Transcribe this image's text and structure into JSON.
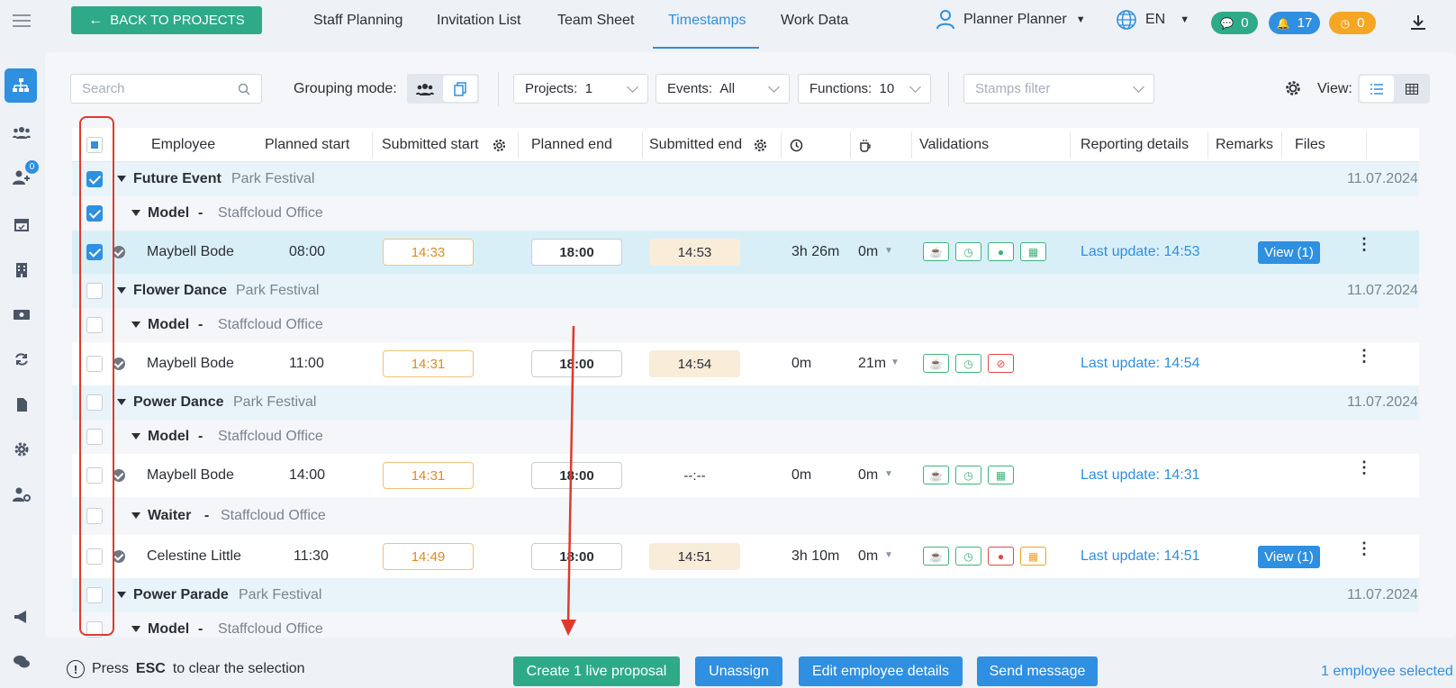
{
  "topbar": {
    "back_label": "BACK TO PROJECTS",
    "tabs": [
      "Staff Planning",
      "Invitation List",
      "Team Sheet",
      "Timestamps",
      "Work Data"
    ],
    "user_name": "Planner Planner",
    "language": "EN",
    "messages_count": "0",
    "notifications_count": "17",
    "alerts_count": "0"
  },
  "sidebar": {
    "badge": "0"
  },
  "filters": {
    "search_placeholder": "Search",
    "grouping_label": "Grouping mode:",
    "projects_label": "Projects:",
    "projects_value": "1",
    "events_label": "Events:",
    "events_value": "All",
    "functions_label": "Functions:",
    "functions_value": "10",
    "stamps_placeholder": "Stamps filter",
    "view_label": "View:"
  },
  "table": {
    "headers": {
      "employee": "Employee",
      "planned_start": "Planned start",
      "submitted_start": "Submitted start",
      "planned_end": "Planned end",
      "submitted_end": "Submitted end",
      "validations": "Validations",
      "reporting": "Reporting details",
      "remarks": "Remarks",
      "files": "Files"
    },
    "events": [
      {
        "name": "Future Event",
        "place": "Park Festival",
        "date": "11.07.2024"
      },
      {
        "name": "Flower Dance",
        "place": "Park Festival",
        "date": "11.07.2024"
      },
      {
        "name": "Power Dance",
        "place": "Park Festival",
        "date": "11.07.2024"
      },
      {
        "name": "Power Parade",
        "place": "Park Festival",
        "date": "11.07.2024"
      }
    ],
    "functions": [
      {
        "name": "Model",
        "sep": "-",
        "office": "Staffcloud Office"
      },
      {
        "name": "Model",
        "sep": "-",
        "office": "Staffcloud Office"
      },
      {
        "name": "Model",
        "sep": "-",
        "office": "Staffcloud Office"
      },
      {
        "name": "Waiter",
        "sep": "-",
        "office": "Staffcloud Office"
      },
      {
        "name": "Model",
        "sep": "-",
        "office": "Staffcloud Office"
      }
    ],
    "employees": [
      {
        "name": "Maybell Bode",
        "planned_start": "08:00",
        "submitted_start": "14:33",
        "planned_end": "18:00",
        "submitted_end": "14:53",
        "duration": "3h 26m",
        "break": "0m",
        "reporting": "Last update: 14:53",
        "files": "View (1)"
      },
      {
        "name": "Maybell Bode",
        "planned_start": "11:00",
        "submitted_start": "14:31",
        "planned_end": "18:00",
        "submitted_end": "14:54",
        "duration": "0m",
        "break": "21m",
        "reporting": "Last update: 14:54",
        "files": ""
      },
      {
        "name": "Maybell Bode",
        "planned_start": "14:00",
        "submitted_start": "14:31",
        "planned_end": "18:00",
        "submitted_end": "--:--",
        "duration": "0m",
        "break": "0m",
        "reporting": "Last update: 14:31",
        "files": ""
      },
      {
        "name": "Celestine Little",
        "planned_start": "11:30",
        "submitted_start": "14:49",
        "planned_end": "18:00",
        "submitted_end": "14:51",
        "duration": "3h 10m",
        "break": "0m",
        "reporting": "Last update: 14:51",
        "files": "View (1)"
      }
    ]
  },
  "bottom": {
    "hint_prefix": "Press",
    "hint_key": "ESC",
    "hint_suffix": "to clear the selection",
    "create_label": "Create 1 live proposal",
    "unassign_label": "Unassign",
    "edit_label": "Edit employee details",
    "message_label": "Send message",
    "selected_text": "1 employee selected"
  },
  "colors": {
    "accent": "#2f8fe0",
    "green": "#2eaa89",
    "annotation": "#e0392b"
  }
}
